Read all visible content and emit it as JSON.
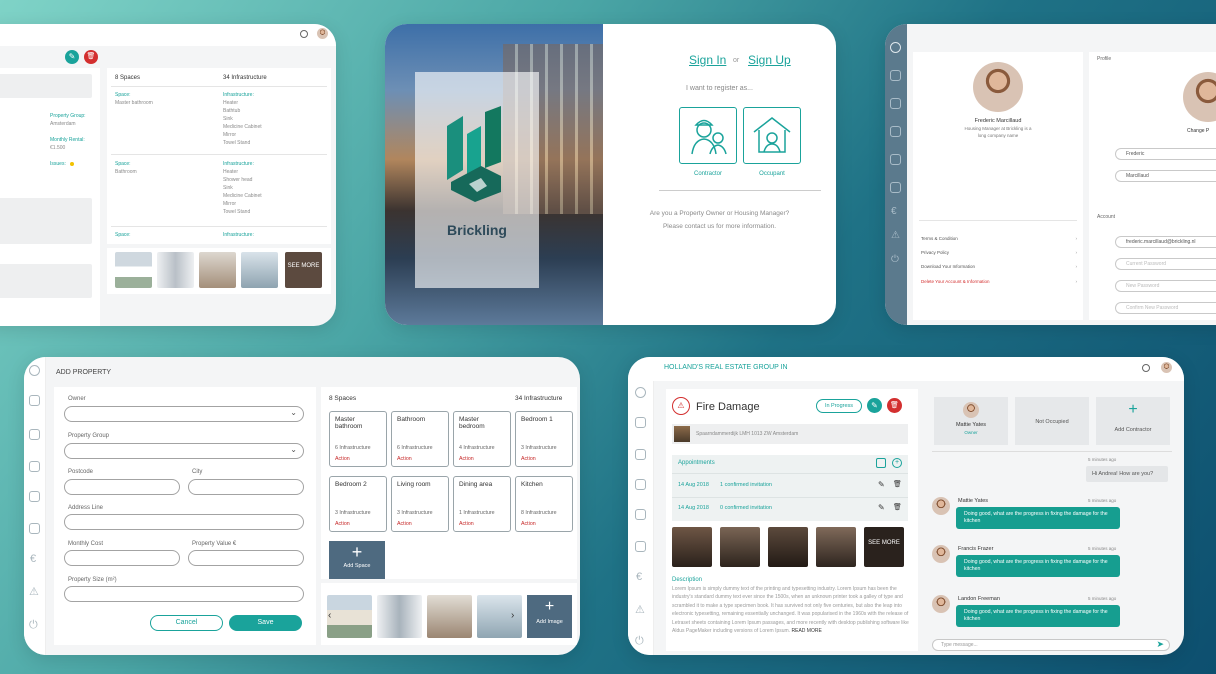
{
  "card1": {
    "spaces_count": "8 Spaces",
    "infra_count": "34 Infrastructure",
    "fields": [
      {
        "label": "Property Group:",
        "value": "Amsterdam"
      },
      {
        "label": "Monthly Rental:",
        "value": "€1.500"
      },
      {
        "label": "Issues:",
        "value": ""
      }
    ],
    "groups": [
      {
        "space_label": "Space:",
        "space": "Master bathroom",
        "infra_label": "Infrastructure:",
        "items": [
          "Heater",
          "Bathtub",
          "Sink",
          "Medicine Cabinet",
          "Mirror",
          "Towel Stand"
        ]
      },
      {
        "space_label": "Space:",
        "space": "Bathroom",
        "infra_label": "Infrastructure:",
        "items": [
          "Heater",
          "Shower head",
          "Sink",
          "Medicine Cabinet",
          "Mirror",
          "Towel Stand"
        ]
      },
      {
        "space_label": "Space:",
        "space": "",
        "infra_label": "Infrastructure:",
        "items": []
      }
    ],
    "see_more": "SEE MORE"
  },
  "card2": {
    "brand": "Brickling",
    "sign_in": "Sign In",
    "or": "or",
    "sign_up": "Sign Up",
    "prompt": "I want to register as...",
    "roles": [
      "Contractor",
      "Occupant"
    ],
    "footer_line1": "Are you a Property Owner or Housing Manager?",
    "footer_line2": "Please contact us for more information."
  },
  "card3": {
    "name": "Frederic Marcillaud",
    "role_line1": "Housing Manager at Brickling is a",
    "role_line2": "long company name",
    "profile_heading": "Profile",
    "change_photo": "Change P",
    "first_name": "Frederic",
    "last_name": "Marcillaud",
    "account_heading": "Account",
    "email": "frederic.marcillaud@brickling.nl",
    "password_placeholders": [
      "Current Password",
      "New Password",
      "Confirm New Password"
    ],
    "links": [
      "Terms & Condition",
      "Privacy Policy",
      "Download Your Information",
      "Delete Your Account & Information"
    ]
  },
  "card4": {
    "title": "ADD PROPERTY",
    "labels": {
      "owner": "Owner",
      "group": "Property Group",
      "postcode": "Postcode",
      "city": "City",
      "address": "Address Line",
      "monthly": "Monthly Cost",
      "value": "Property Value €",
      "size": "Property Size (m²)"
    },
    "cancel": "Cancel",
    "save": "Save",
    "spaces_count": "8 Spaces",
    "infra_count": "34 Infrastructure",
    "spaces": [
      {
        "name": "Master bathroom",
        "infra": "6 Infrastructure",
        "action": "Action"
      },
      {
        "name": "Bathroom",
        "infra": "6 Infrastructure",
        "action": "Action"
      },
      {
        "name": "Master bedroom",
        "infra": "4 Infrastructure",
        "action": "Action"
      },
      {
        "name": "Bedroom 1",
        "infra": "3 Infrastructure",
        "action": "Action"
      },
      {
        "name": "Bedroom 2",
        "infra": "3 Infrastructure",
        "action": "Action"
      },
      {
        "name": "Living room",
        "infra": "3 Infrastructure",
        "action": "Action"
      },
      {
        "name": "Dining area",
        "infra": "1 Infrastructure",
        "action": "Action"
      },
      {
        "name": "Kitchen",
        "infra": "8 Infrastructure",
        "action": "Action"
      }
    ],
    "add_space": "Add Space",
    "add_image": "Add Image"
  },
  "card5": {
    "header": "HOLLAND'S REAL ESTATE GROUP IN",
    "issue_title": "Fire Damage",
    "status": "In Progress",
    "address": "Spaarndammerdijk LMH 1013 ZW Amsterdam",
    "appointments": "Appointments",
    "appt_rows": [
      {
        "date": "14 Aug 2018",
        "text": "1 confirmed invitation"
      },
      {
        "date": "14 Aug 2018",
        "text": "0 confirmed invitation"
      }
    ],
    "see_more": "SEE MORE",
    "desc_label": "Description",
    "desc_text": "Lorem Ipsum is simply dummy text of the printing and typesetting industry. Lorem Ipsum has been the industry's standard dummy text ever since the 1500s, when an unknown printer took a galley of type and scrambled it to make a type specimen book. It has survived not only five centuries, but also the leap into electronic typesetting, remaining essentially unchanged. It was popularised in the 1960s with the release of Letraset sheets containing Lorem Ipsum passages, and more recently with desktop publishing software like Aldus PageMaker including versions of Lorem Ipsum.",
    "read_more": "READ MORE",
    "contact_name": "Mattie Yates",
    "contact_role": "Owner",
    "not_occupied": "Not Occupied",
    "add_contractor": "Add Contractor",
    "chat_time": "5 minutes ago",
    "own_msg": "Hi Andrea! How are you?",
    "msgs": [
      {
        "name": "Mattie Yates",
        "time": "5 minutes ago",
        "text": "Doing good, what are the progress in fixing the damage for the kitchen"
      },
      {
        "name": "Francis Frazer",
        "time": "5 minutes ago",
        "text": "Doing good, what are the progress in fixing the damage for the kitchen"
      },
      {
        "name": "Landon Freeman",
        "time": "5 minutes ago",
        "text": "Doing good, what are the progress in fixing the damage for the kitchen"
      }
    ],
    "type_placeholder": "Type message..."
  },
  "colors": {
    "teal": "#1aa39b",
    "red": "#d32f2f",
    "slate": "#4e6a80"
  }
}
